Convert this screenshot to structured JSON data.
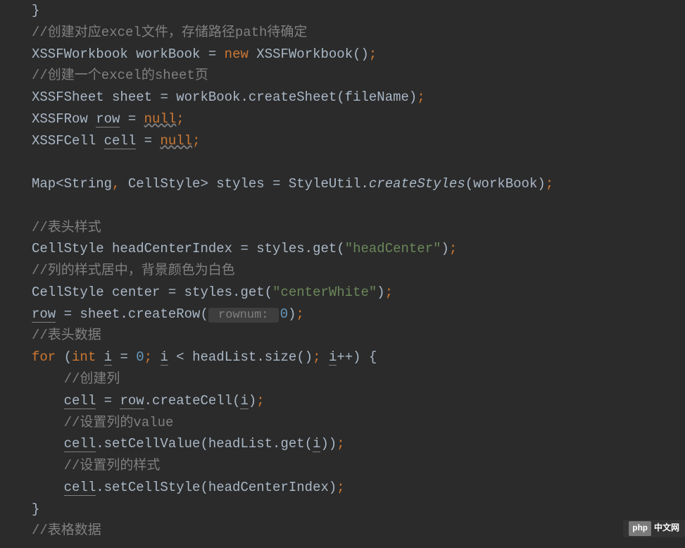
{
  "code": {
    "line0": "}",
    "comment1": "//创建对应excel文件，存储路径path待确定",
    "line2_type1": "XSSFWorkbook",
    "line2_var": " workBook ",
    "line2_eq": "= ",
    "line2_new": "new",
    "line2_type2": " XSSFWorkbook()",
    "line2_semi": ";",
    "comment3": "//创建一个excel的sheet页",
    "line4_type": "XSSFSheet",
    "line4_rest": " sheet = workBook.createSheet(fileName)",
    "line4_semi": ";",
    "line5_type": "XSSFRow ",
    "line5_var": "row",
    "line5_eq": " = ",
    "line5_null": "null",
    "line5_semi": ";",
    "line6_type": "XSSFCell ",
    "line6_var": "cell",
    "line6_eq": " = ",
    "line6_null": "null",
    "line6_semi": ";",
    "line8_pre": "Map<String",
    "line8_comma": ",",
    "line8_mid": " CellStyle> styles = StyleUtil.",
    "line8_method": "createStyles",
    "line8_post": "(workBook)",
    "line8_semi": ";",
    "comment10": "//表头样式",
    "line11_pre": "CellStyle headCenterIndex = styles.get(",
    "line11_str": "\"headCenter\"",
    "line11_post": ")",
    "line11_semi": ";",
    "comment12": "//列的样式居中，背景颜色为白色",
    "line13_pre": "CellStyle center = styles.get(",
    "line13_str": "\"centerWhite\"",
    "line13_post": ")",
    "line13_semi": ";",
    "line14_var": "row",
    "line14_mid": " = sheet.createRow(",
    "line14_hint": " rownum: ",
    "line14_num": "0",
    "line14_post": ")",
    "line14_semi": ";",
    "comment15": "//表头数据",
    "line16_for": "for",
    "line16_p1": " (",
    "line16_int": "int",
    "line16_sp1": " ",
    "line16_i1": "i",
    "line16_eq": " = ",
    "line16_zero": "0",
    "line16_semi1": ";",
    "line16_sp2": " ",
    "line16_i2": "i",
    "line16_cond": " < headList.size()",
    "line16_semi2": ";",
    "line16_sp3": " ",
    "line16_i3": "i",
    "line16_inc": "++) {",
    "comment17": "//创建列",
    "line18_var": "cell",
    "line18_mid": " = ",
    "line18_row": "row",
    "line18_call": ".createCell(",
    "line18_i": "i",
    "line18_post": ")",
    "line18_semi": ";",
    "comment19": "//设置列的value",
    "line20_var": "cell",
    "line20_call": ".setCellValue(headList.get(",
    "line20_i": "i",
    "line20_post": "))",
    "line20_semi": ";",
    "comment21": "//设置列的样式",
    "line22_var": "cell",
    "line22_call": ".setCellStyle(headCenterIndex)",
    "line22_semi": ";",
    "line23": "}",
    "comment24": "//表格数据"
  },
  "badge": {
    "text": "php",
    "suffix": "中文网"
  }
}
